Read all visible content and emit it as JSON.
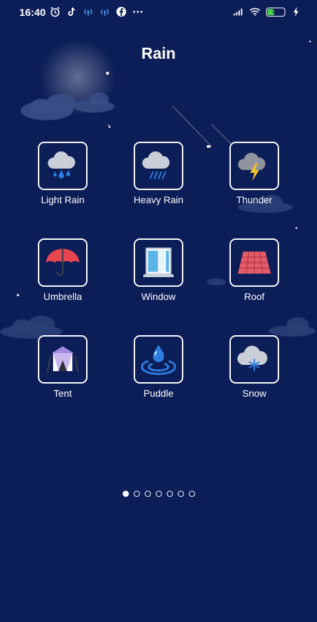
{
  "status_bar": {
    "time": "16:40",
    "battery_level": "39",
    "left_icons": [
      "alarm-icon",
      "tiktok-icon",
      "broadcast-icon",
      "broadcast-icon",
      "facebook-icon",
      "more-dots-icon"
    ],
    "right_icons": [
      "signal-icon",
      "wifi-icon",
      "battery-icon",
      "charging-icon"
    ]
  },
  "page": {
    "title": "Rain"
  },
  "tiles": [
    {
      "label": "Light Rain",
      "icon": "light-rain-icon"
    },
    {
      "label": "Heavy Rain",
      "icon": "heavy-rain-icon"
    },
    {
      "label": "Thunder",
      "icon": "thunder-icon"
    },
    {
      "label": "Umbrella",
      "icon": "umbrella-icon"
    },
    {
      "label": "Window",
      "icon": "window-icon"
    },
    {
      "label": "Roof",
      "icon": "roof-icon"
    },
    {
      "label": "Tent",
      "icon": "tent-icon"
    },
    {
      "label": "Puddle",
      "icon": "puddle-icon"
    },
    {
      "label": "Snow",
      "icon": "snow-icon"
    }
  ],
  "pagination": {
    "total_pages": 7,
    "active_page": 1
  },
  "colors": {
    "background": "#0c1e57",
    "tile_border": "#ffffff",
    "cloud": "#c9ced8",
    "rain": "#2f7de1",
    "umbrella": "#e8454f",
    "roof": "#e45b6a",
    "bolt": "#f6c12d",
    "tent": "#a48be0"
  }
}
